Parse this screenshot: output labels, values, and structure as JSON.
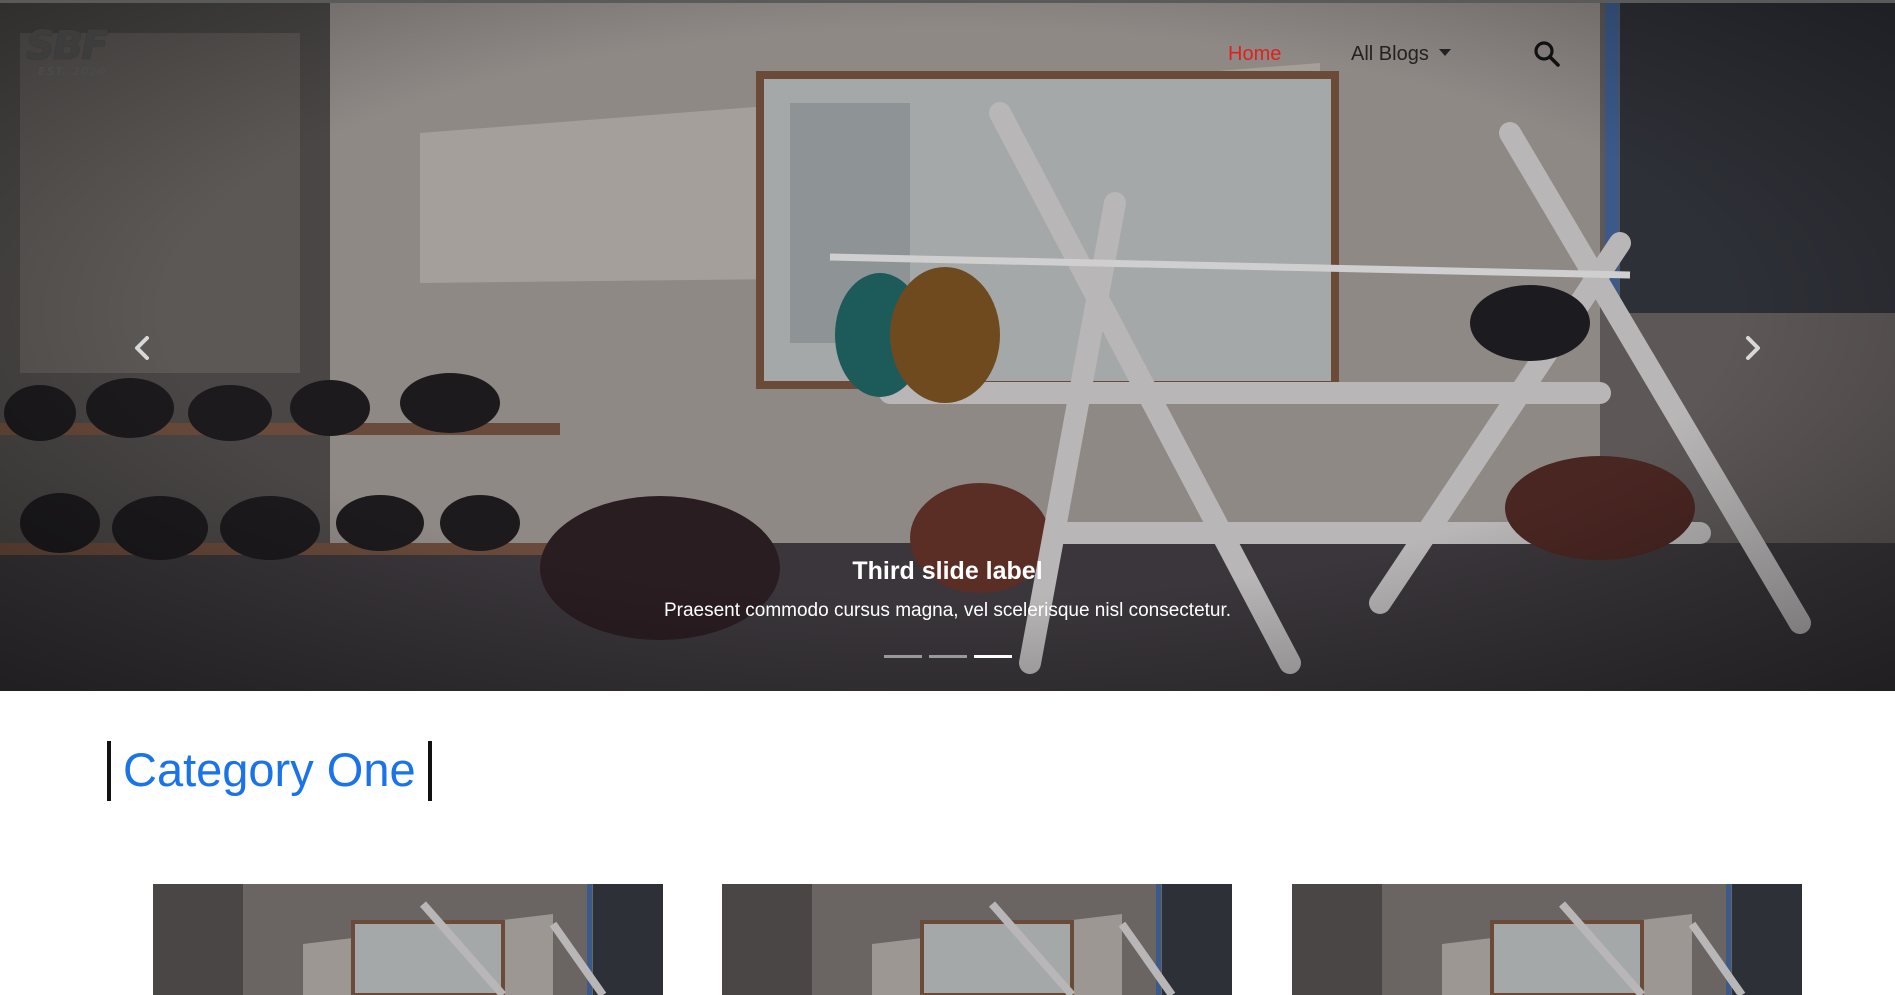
{
  "brand": {
    "logo_text": "SBF",
    "logo_sub": "EST. 2020"
  },
  "nav": {
    "home_label": "Home",
    "blogs_label": "All Blogs",
    "search_icon": "search-icon"
  },
  "carousel": {
    "caption_title": "Third slide label",
    "caption_text": "Praesent commodo cursus magna, vel scelerisque nisl consectetur.",
    "slide_count": 3,
    "active_index": 2,
    "prev_icon": "chevron-left-icon",
    "next_icon": "chevron-right-icon"
  },
  "category": {
    "title": "Category One"
  },
  "colors": {
    "accent_blue": "#1a73e8",
    "active_nav_red": "#e0211b"
  }
}
